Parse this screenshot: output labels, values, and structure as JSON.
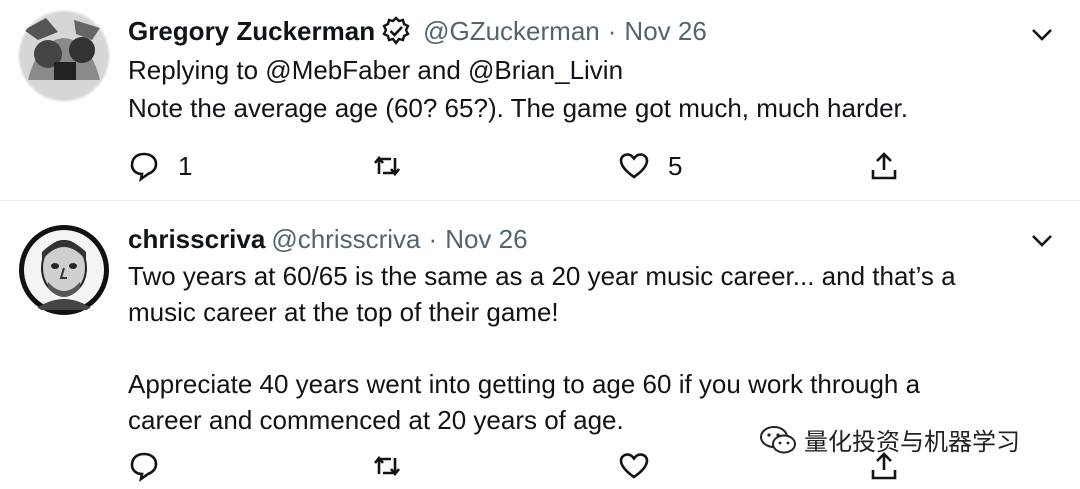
{
  "tweets": [
    {
      "name": "Gregory Zuckerman",
      "verified": true,
      "handle": "@GZuckerman",
      "separator": "·",
      "date": "Nov 26",
      "reply_to": "Replying to @MebFaber and @Brian_Livin",
      "text": "Note the average age (60? 65?). The game got much, much harder.",
      "reply_count": "1",
      "retweet_count": "",
      "like_count": "5"
    },
    {
      "name": "chrisscriva",
      "verified": false,
      "handle": "@chrisscriva",
      "separator": "·",
      "date": "Nov 26",
      "text": "Two years at 60/65 is the same as a 20 year music career... and that’s a\nmusic career at the top of their game!\n\nAppreciate 40 years went into getting to age 60 if you work through a\ncareer and commenced at 20 years of age.",
      "reply_count": "",
      "retweet_count": "",
      "like_count": ""
    }
  ],
  "watermark": "量化投资与机器学习",
  "icons": [
    "verified-badge-icon",
    "caret-down-icon",
    "reply-icon",
    "retweet-icon",
    "like-icon",
    "share-icon",
    "wechat-icon"
  ],
  "colors": {
    "text": "#0f1419",
    "secondary": "#536471",
    "divider": "#e6ecf0"
  }
}
